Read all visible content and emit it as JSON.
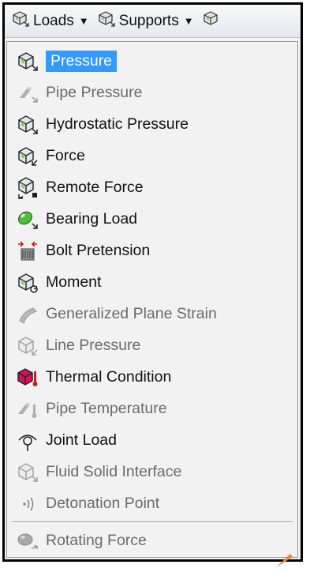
{
  "toolbar": {
    "loads_label": "Loads",
    "supports_label": "Supports"
  },
  "menu": {
    "items": [
      {
        "label": "Pressure",
        "icon": "pressure-icon",
        "state": "selected"
      },
      {
        "label": "Pipe Pressure",
        "icon": "pipe-pressure-icon",
        "state": "disabled"
      },
      {
        "label": "Hydrostatic Pressure",
        "icon": "hydrostatic-pressure-icon",
        "state": "enabled"
      },
      {
        "label": "Force",
        "icon": "force-icon",
        "state": "enabled"
      },
      {
        "label": "Remote Force",
        "icon": "remote-force-icon",
        "state": "enabled"
      },
      {
        "label": "Bearing Load",
        "icon": "bearing-load-icon",
        "state": "enabled"
      },
      {
        "label": "Bolt Pretension",
        "icon": "bolt-pretension-icon",
        "state": "enabled"
      },
      {
        "label": "Moment",
        "icon": "moment-icon",
        "state": "enabled"
      },
      {
        "label": "Generalized Plane Strain",
        "icon": "plane-strain-icon",
        "state": "disabled"
      },
      {
        "label": "Line Pressure",
        "icon": "line-pressure-icon",
        "state": "disabled"
      },
      {
        "label": "Thermal Condition",
        "icon": "thermal-condition-icon",
        "state": "enabled"
      },
      {
        "label": "Pipe Temperature",
        "icon": "pipe-temperature-icon",
        "state": "disabled"
      },
      {
        "label": "Joint Load",
        "icon": "joint-load-icon",
        "state": "enabled"
      },
      {
        "label": "Fluid Solid Interface",
        "icon": "fluid-solid-interface-icon",
        "state": "disabled"
      },
      {
        "label": "Detonation Point",
        "icon": "detonation-point-icon",
        "state": "disabled"
      },
      {
        "label": "Rotating Force",
        "icon": "rotating-force-icon",
        "state": "disabled"
      }
    ]
  },
  "colors": {
    "selection": "#3399ff",
    "disabled_text": "#6b6b6b",
    "cursor": "#e8833a"
  }
}
